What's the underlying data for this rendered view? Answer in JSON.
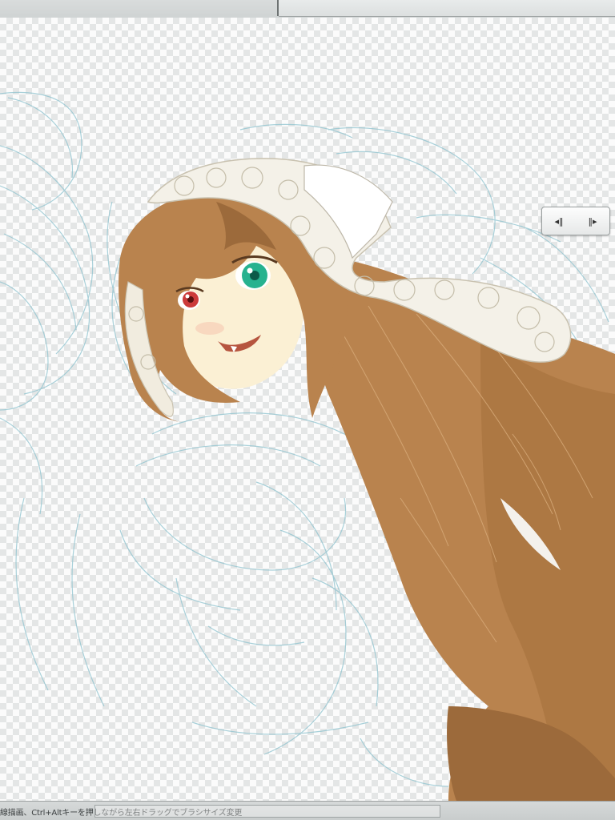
{
  "status_bar": {
    "hint_text": "線描画、Ctrl+Altキーを押しながら左右ドラッグでブラシサイズ変更"
  },
  "frame_nav": {
    "prev_icon": "◂‖",
    "next_icon": "‖▸"
  },
  "colors": {
    "hair": "#b9834e",
    "hair_shadow": "#9c6a3b",
    "skin": "#fbf0d4",
    "headdress": "#f4f1e8",
    "sketch_line": "#8ec3cf",
    "left_eye": "#cc3a3a",
    "right_eye": "#27b28f"
  }
}
